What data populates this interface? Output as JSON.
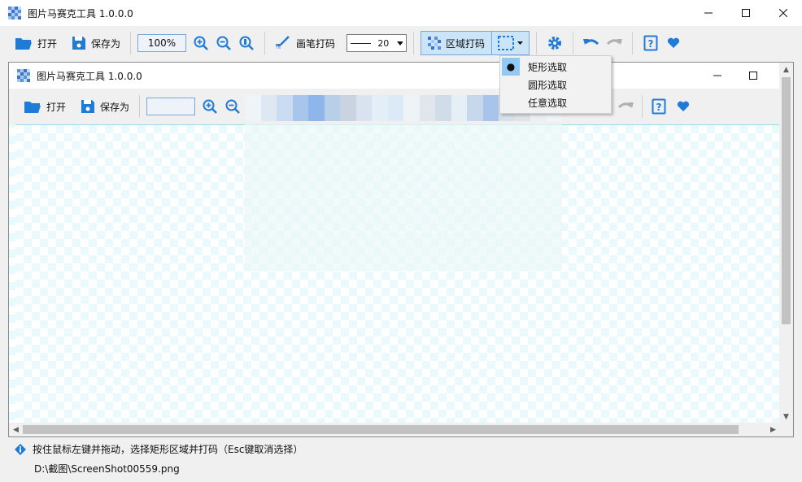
{
  "window": {
    "title": "图片马赛克工具 1.0.0.0"
  },
  "toolbar": {
    "open_label": "打开",
    "save_label": "保存为",
    "zoom_value": "100%",
    "brush_label": "画笔打码",
    "brush_size": "20",
    "region_label": "区域打码"
  },
  "dropdown": {
    "items": [
      {
        "label": "矩形选取",
        "selected": true
      },
      {
        "label": "圆形选取",
        "selected": false
      },
      {
        "label": "任意选取",
        "selected": false
      }
    ]
  },
  "inner_window": {
    "title": "图片马赛克工具 1.0.0.0",
    "open_label": "打开",
    "save_label": "保存为"
  },
  "status": {
    "hint": "按住鼠标左键并拖动，选择矩形区域并打码（Esc键取消选择）",
    "file_path": "D:\\截图\\ScreenShot00559.png"
  },
  "colors": {
    "accent": "#1e7bd8",
    "selection_bg": "#cce4f7",
    "checker": "#e6fbfb"
  }
}
